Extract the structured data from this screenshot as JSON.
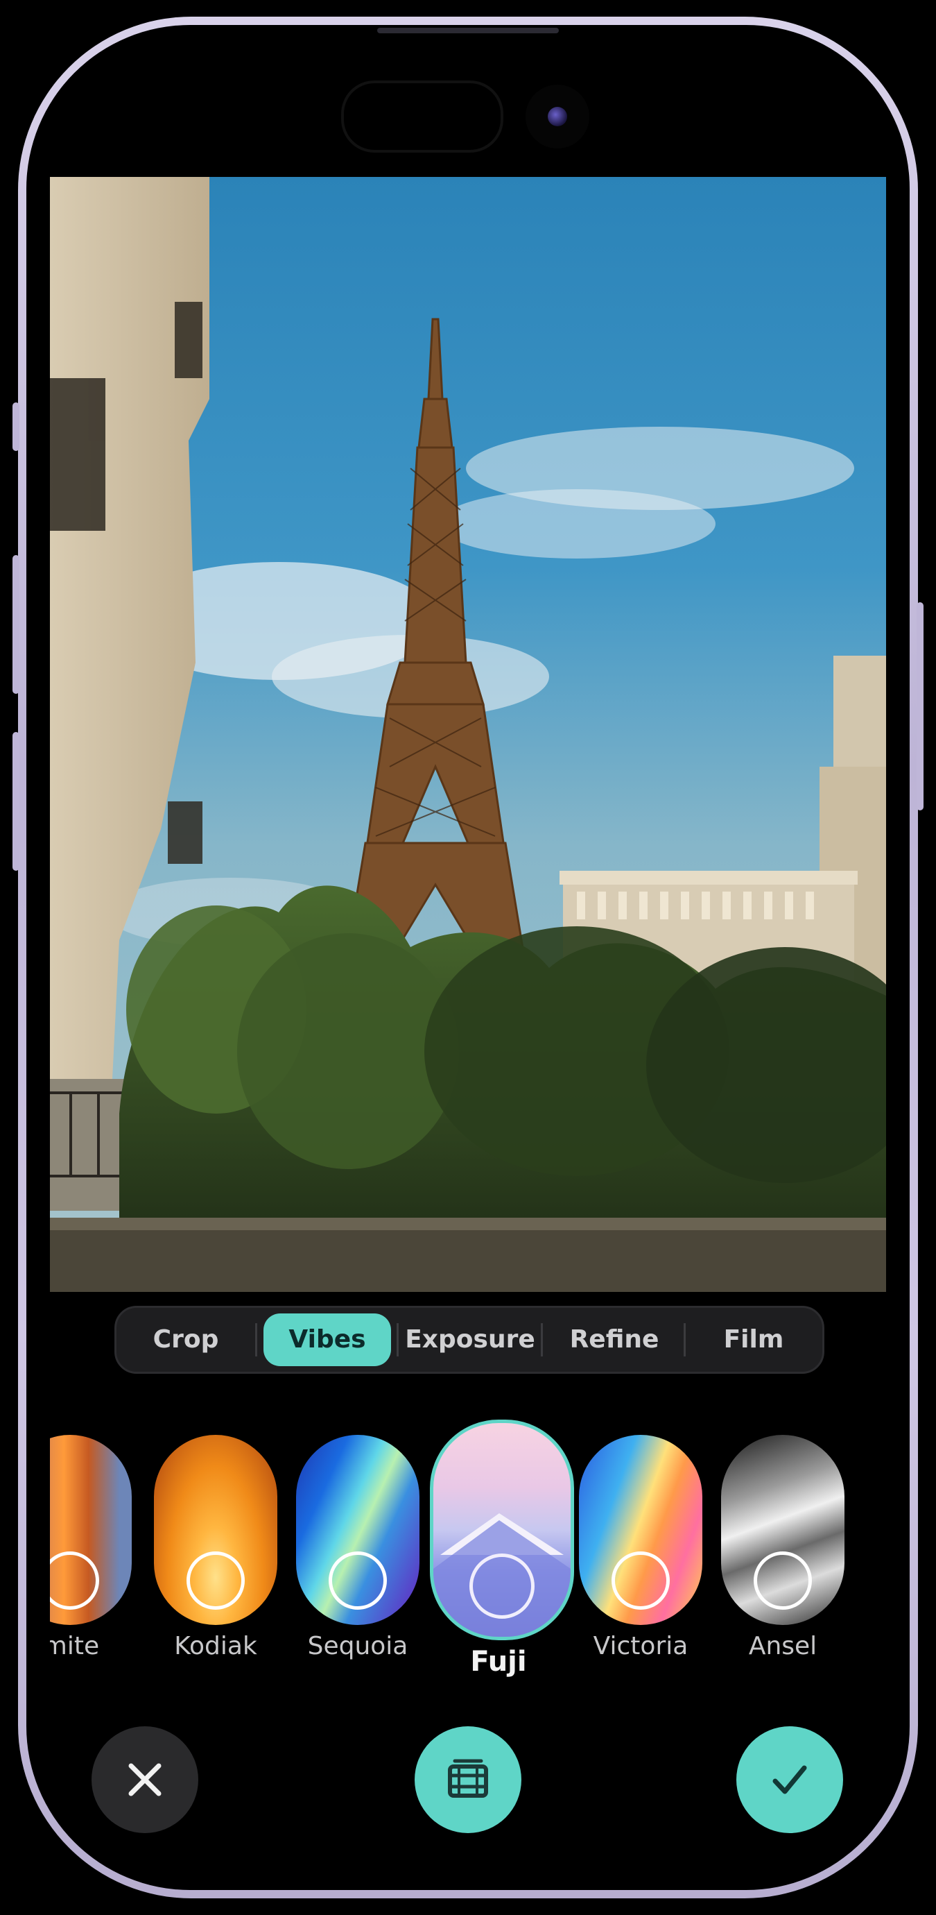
{
  "editor": {
    "tabs": [
      {
        "label": "Crop"
      },
      {
        "label": "Vibes"
      },
      {
        "label": "Exposure"
      },
      {
        "label": "Refine"
      },
      {
        "label": "Film"
      }
    ],
    "active_tab": "Vibes",
    "vibes": [
      {
        "label": "semite"
      },
      {
        "label": "Kodiak"
      },
      {
        "label": "Sequoia"
      },
      {
        "label": "Fuji"
      },
      {
        "label": "Victoria"
      },
      {
        "label": "Ansel"
      }
    ],
    "selected_vibe": "Fuji"
  },
  "colors": {
    "accent": "#5fd5c7",
    "background": "#000000",
    "tab_bar": "#1e1e20",
    "frame": "#c9c1e0"
  },
  "icons": {
    "cancel": "close-icon",
    "film": "film-icon",
    "confirm": "checkmark-icon"
  }
}
